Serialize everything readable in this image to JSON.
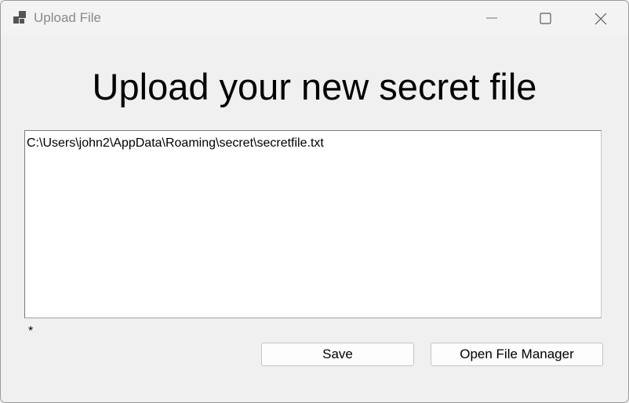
{
  "window": {
    "title": "Upload File"
  },
  "heading": "Upload your new secret file",
  "file_path_box": {
    "value": "C:\\Users\\john2\\AppData\\Roaming\\secret\\secretfile.txt"
  },
  "status_label": "*",
  "buttons": {
    "save_label": "Save",
    "open_file_manager_label": "Open File Manager"
  },
  "icons": {
    "app": "app-window-icon",
    "minimize": "minimize-icon",
    "maximize": "maximize-icon",
    "close": "close-icon"
  }
}
